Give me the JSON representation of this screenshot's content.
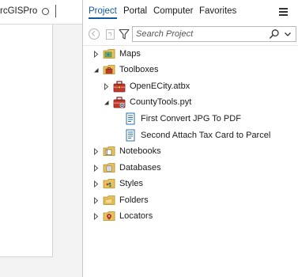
{
  "left_panel": {
    "tab_label": "rcGISPro"
  },
  "tabs": [
    {
      "label": "Project",
      "active": true
    },
    {
      "label": "Portal",
      "active": false
    },
    {
      "label": "Computer",
      "active": false
    },
    {
      "label": "Favorites",
      "active": false
    }
  ],
  "search": {
    "placeholder": "Search Project",
    "value": ""
  },
  "tree": [
    {
      "label": "Maps",
      "icon": "maps-folder-icon",
      "state": "collapsed"
    },
    {
      "label": "Toolboxes",
      "icon": "toolboxes-folder-icon",
      "state": "expanded"
    },
    {
      "label": "OpenECity.atbx",
      "icon": "toolbox-icon",
      "state": "collapsed"
    },
    {
      "label": "CountyTools.pyt",
      "icon": "python-toolbox-icon",
      "state": "expanded"
    },
    {
      "label": "First Convert JPG To PDF",
      "icon": "script-tool-icon",
      "state": "leaf"
    },
    {
      "label": "Second Attach Tax Card to Parcel",
      "icon": "script-tool-icon",
      "state": "leaf"
    },
    {
      "label": "Notebooks",
      "icon": "notebooks-folder-icon",
      "state": "collapsed"
    },
    {
      "label": "Databases",
      "icon": "databases-folder-icon",
      "state": "collapsed"
    },
    {
      "label": "Styles",
      "icon": "styles-folder-icon",
      "state": "collapsed"
    },
    {
      "label": "Folders",
      "icon": "folders-folder-icon",
      "state": "collapsed"
    },
    {
      "label": "Locators",
      "icon": "locators-folder-icon",
      "state": "collapsed"
    }
  ],
  "colors": {
    "accent": "#13579f",
    "folder": "#e8c25a",
    "toolbox_red": "#c0392b",
    "script_blue": "#2a6fb0"
  }
}
